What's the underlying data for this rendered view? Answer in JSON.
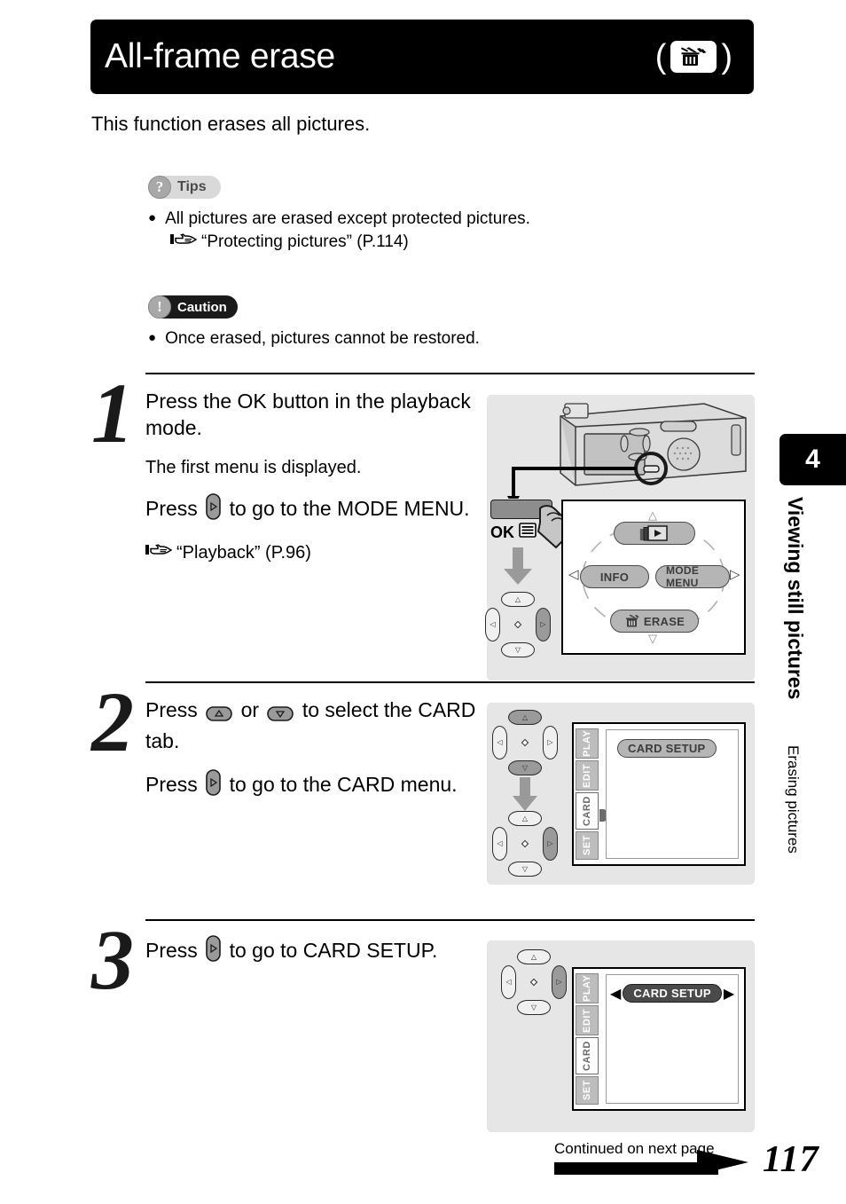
{
  "header": {
    "title": "All-frame erase",
    "icon_open_paren": "(",
    "icon_close_paren": ")",
    "erase_icon_name": "erase-trash-icon"
  },
  "intro": "This function erases all pictures.",
  "tips": {
    "badge_label": "Tips",
    "badge_glyph": "?",
    "bullets": [
      "All pictures are erased except protected pictures."
    ],
    "reference": "“Protecting pictures” (P.114)"
  },
  "caution": {
    "badge_label": "Caution",
    "badge_glyph": "!",
    "bullets": [
      "Once erased, pictures cannot be restored."
    ]
  },
  "steps": [
    {
      "number": "1",
      "lines": [
        "Press the OK button in the playback mode.",
        "The first menu is displayed."
      ],
      "line3_before": "Press",
      "line3_after": "to go to the MODE MENU.",
      "reference": "“Playback” (P.96)",
      "diagram": {
        "ok_label": "OK",
        "menu_items": {
          "top": "playback-thumbnails-icon",
          "left": "INFO",
          "right": "MODE MENU",
          "bottom": "ERASE"
        }
      }
    },
    {
      "number": "2",
      "line1_before": "Press",
      "line1_mid": "or",
      "line1_after": "to select the CARD tab.",
      "line2_before": "Press",
      "line2_after": "to go to the CARD menu.",
      "diagram": {
        "tabs": [
          "PLAY",
          "EDIT",
          "CARD",
          "SET"
        ],
        "selected_tab": "CARD",
        "menu_entry": "CARD SETUP"
      }
    },
    {
      "number": "3",
      "line1_before": "Press",
      "line1_after": "to go to CARD SETUP.",
      "diagram": {
        "tabs": [
          "PLAY",
          "EDIT",
          "CARD",
          "SET"
        ],
        "selected_tab": "CARD",
        "menu_entry": "CARD SETUP"
      }
    }
  ],
  "sidebar": {
    "chapter_number": "4",
    "chapter_title": "Viewing still pictures",
    "section_title": "Erasing pictures"
  },
  "footer": {
    "continued": "Continued on next page",
    "page_number": "117"
  },
  "colors": {
    "title_bar": "#000000",
    "panel_bg": "#e6e6e6",
    "pill_gray": "#b5b5b5",
    "pill_dark": "#4a4a4a",
    "tab_gray": "#bdbdbd"
  }
}
